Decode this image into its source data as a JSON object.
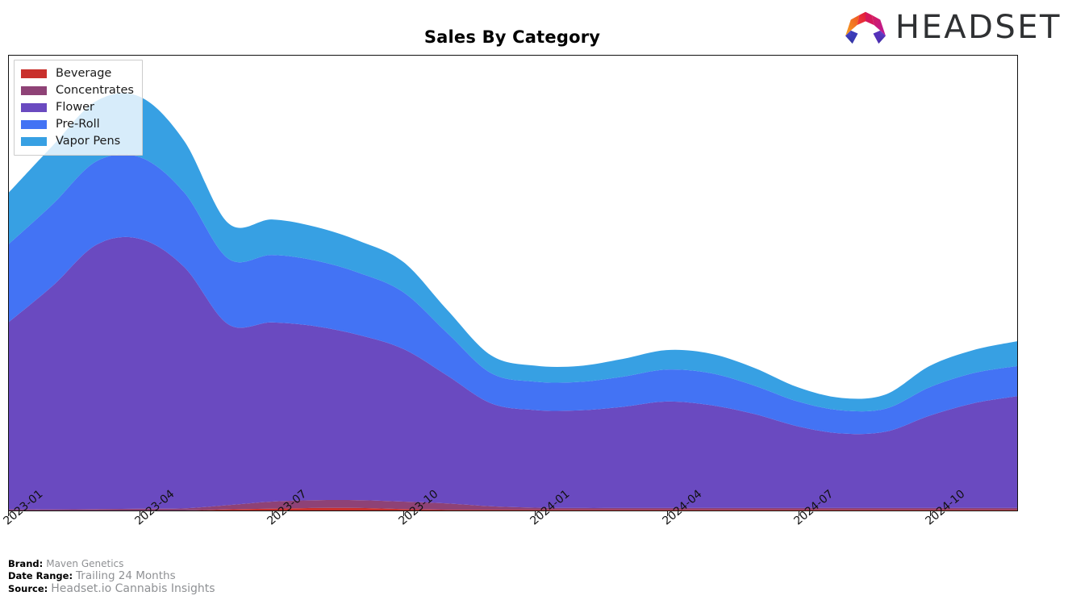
{
  "header": {
    "title": "Sales By Category",
    "logo_word": "HEADSET",
    "logo_mark": "headset-hexagon-icon"
  },
  "footer": {
    "brand_key": "Brand:",
    "brand_value": "Maven Genetics",
    "date_range_key": "Date Range:",
    "date_range_value": "Trailing 24 Months",
    "source_key": "Source:",
    "source_value": "Headset.io Cannabis Insights"
  },
  "chart_data": {
    "type": "area",
    "title": "Sales By Category",
    "xlabel": "",
    "ylabel": "",
    "stacked": true,
    "grid": false,
    "legend_position": "upper-left",
    "axis_tick_labels": [
      "2023-01",
      "2023-04",
      "2023-07",
      "2023-10",
      "2024-01",
      "2024-04",
      "2024-07",
      "2024-10"
    ],
    "x": [
      "2023-01",
      "2023-02",
      "2023-03",
      "2023-04",
      "2023-05",
      "2023-06",
      "2023-07",
      "2023-08",
      "2023-09",
      "2023-10",
      "2023-11",
      "2023-12",
      "2024-01",
      "2024-02",
      "2024-03",
      "2024-04",
      "2024-05",
      "2024-06",
      "2024-07",
      "2024-08",
      "2024-09",
      "2024-10",
      "2024-11",
      "2024-12"
    ],
    "categories": [
      "Beverage",
      "Concentrates",
      "Flower",
      "Pre-Roll",
      "Vapor Pens"
    ],
    "colors": {
      "Beverage": "#c9302c",
      "Concentrates": "#8e4276",
      "Flower": "#6a4ac0",
      "Pre-Roll": "#4373f4",
      "Vapor Pens": "#37a0e3"
    },
    "series": [
      {
        "name": "Beverage",
        "color": "#c9302c",
        "values": [
          0,
          0,
          0,
          0,
          0,
          0.3,
          0.5,
          0.7,
          0.7,
          0.4,
          0.2,
          0.2,
          0.2,
          0.2,
          0.2,
          0.2,
          0.2,
          0.2,
          0.2,
          0.2,
          0.2,
          0.2,
          0.2,
          0.2
        ]
      },
      {
        "name": "Concentrates",
        "color": "#8e4276",
        "values": [
          0.3,
          0.3,
          0.4,
          0.5,
          0.6,
          1.2,
          2.0,
          2.2,
          2.2,
          2.1,
          1.8,
          1.0,
          0.6,
          0.5,
          0.5,
          0.5,
          0.5,
          0.5,
          0.5,
          0.5,
          0.5,
          0.5,
          0.5,
          0.5
        ]
      },
      {
        "name": "Flower",
        "color": "#6a4ac0",
        "values": [
          52.8,
          63.0,
          74.5,
          76.0,
          68.0,
          51.0,
          50.5,
          49.0,
          46.5,
          43.0,
          36.0,
          29.0,
          27.5,
          27.5,
          28.5,
          30.0,
          29.0,
          26.5,
          23.0,
          21.0,
          21.5,
          26.0,
          29.5,
          31.5
        ]
      },
      {
        "name": "Pre-Roll",
        "color": "#4373f4",
        "values": [
          22.0,
          23.0,
          23.5,
          23.0,
          21.0,
          18.5,
          19.0,
          18.5,
          17.5,
          16.0,
          12.0,
          8.5,
          8.0,
          8.0,
          8.5,
          9.0,
          9.0,
          8.0,
          7.0,
          6.5,
          6.5,
          8.0,
          8.5,
          8.5
        ]
      },
      {
        "name": "Vapor Pens",
        "color": "#37a0e3",
        "values": [
          14.5,
          16.5,
          17.0,
          17.0,
          14.5,
          10.0,
          10.0,
          9.5,
          9.0,
          8.5,
          6.5,
          5.0,
          4.5,
          4.5,
          5.0,
          5.5,
          5.5,
          5.0,
          4.0,
          3.5,
          4.0,
          6.0,
          6.5,
          7.0
        ]
      }
    ]
  },
  "legend": {
    "items": [
      {
        "label": "Beverage",
        "color": "#c9302c"
      },
      {
        "label": "Concentrates",
        "color": "#8e4276"
      },
      {
        "label": "Flower",
        "color": "#6a4ac0"
      },
      {
        "label": "Pre-Roll",
        "color": "#4373f4"
      },
      {
        "label": "Vapor Pens",
        "color": "#37a0e3"
      }
    ]
  }
}
